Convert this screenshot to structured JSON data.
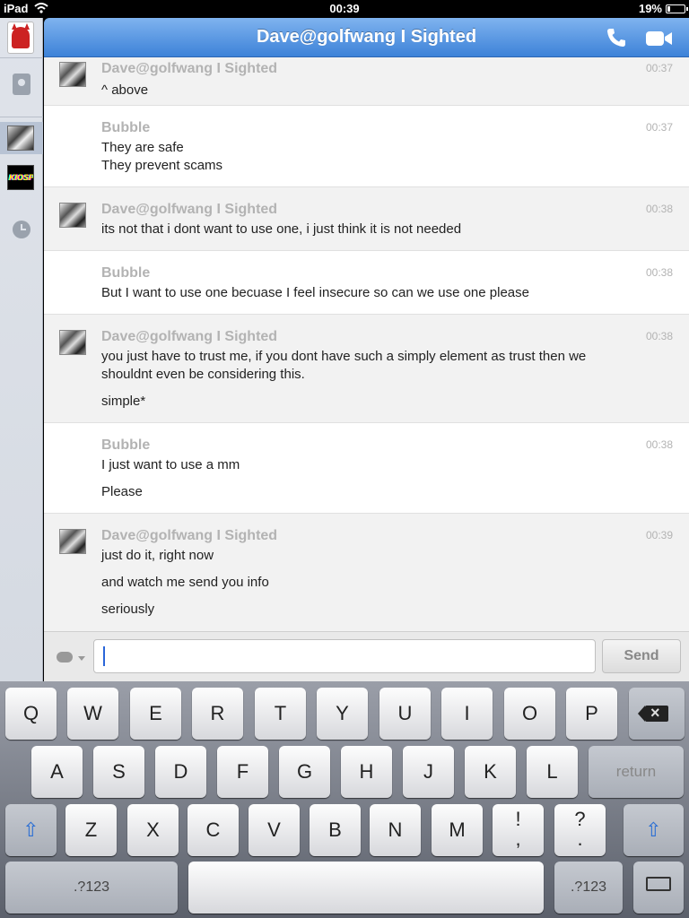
{
  "status_bar": {
    "carrier": "iPad",
    "time": "00:39",
    "battery_pct": "19%",
    "battery_level": 0.19
  },
  "header": {
    "title": "Dave@golfwang I Sighted",
    "call_icon": "phone-icon",
    "video_icon": "video-camera-icon"
  },
  "messages": [
    {
      "sender": "Dave@golfwang I Sighted",
      "time": "00:37",
      "lines": [
        "^ above"
      ],
      "from": "dave"
    },
    {
      "sender": "Bubble",
      "time": "00:37",
      "lines": [
        "They are safe",
        "They prevent scams"
      ],
      "from": "bubble"
    },
    {
      "sender": "Dave@golfwang I Sighted",
      "time": "00:38",
      "lines": [
        "its not that i dont want to use one, i just think it is not needed"
      ],
      "from": "dave"
    },
    {
      "sender": "Bubble",
      "time": "00:38",
      "lines": [
        "But I want to use one becuase I feel insecure so can we use one please"
      ],
      "from": "bubble"
    },
    {
      "sender": "Dave@golfwang I Sighted",
      "time": "00:38",
      "lines": [
        "you just have to trust me, if you dont have such a simply element as trust then we",
        "shouldnt even be considering this.",
        "simple*"
      ],
      "from": "dave"
    },
    {
      "sender": "Bubble",
      "time": "00:38",
      "lines": [
        "I just want to use a mm",
        "Please"
      ],
      "from": "bubble"
    },
    {
      "sender": "Dave@golfwang I Sighted",
      "time": "00:39",
      "lines": [
        "just do it, right now",
        "and watch me send you info",
        "seriously"
      ],
      "from": "dave"
    }
  ],
  "composer": {
    "value": "",
    "send_label": "Send"
  },
  "keyboard": {
    "row1": [
      "Q",
      "W",
      "E",
      "R",
      "T",
      "Y",
      "U",
      "I",
      "O",
      "P"
    ],
    "row2": [
      "A",
      "S",
      "D",
      "F",
      "G",
      "H",
      "J",
      "K",
      "L"
    ],
    "row3": [
      "Z",
      "X",
      "C",
      "V",
      "B",
      "N",
      "M"
    ],
    "return_label": "return",
    "punct1_top": "!",
    "punct1_bottom": ",",
    "punct2_top": "?",
    "punct2_bottom": ".",
    "numbers_label": ".?123"
  }
}
